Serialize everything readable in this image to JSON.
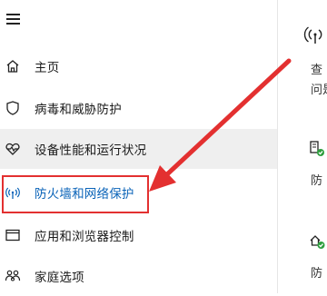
{
  "sidebar": {
    "menu_icon": "hamburger-menu-icon",
    "items": [
      {
        "label": "主页",
        "icon": "home-icon"
      },
      {
        "label": "病毒和威胁防护",
        "icon": "shield-icon"
      },
      {
        "label": "设备性能和运行状况",
        "icon": "heart-icon"
      },
      {
        "label": "防火墙和网络保护",
        "icon": "wifi-antenna-icon"
      },
      {
        "label": "应用和浏览器控制",
        "icon": "browser-window-icon"
      },
      {
        "label": "家庭选项",
        "icon": "family-icon"
      }
    ]
  },
  "right_panel": {
    "line1": "查",
    "line2": "问是",
    "section1": "防",
    "section2": "防"
  },
  "colors": {
    "accent": "#0a63b8",
    "highlight": "#e33030",
    "selected_bg": "#efefef"
  }
}
